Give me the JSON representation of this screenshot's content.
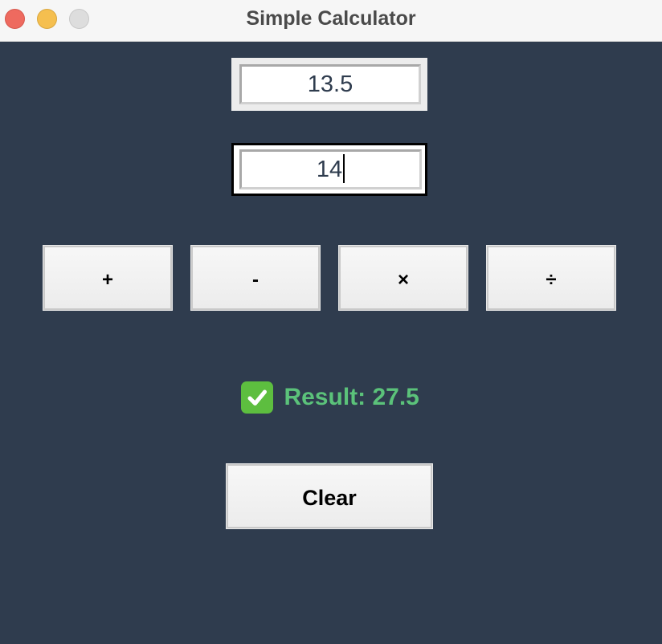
{
  "window": {
    "title": "Simple Calculator",
    "controls": [
      "close-icon",
      "minimize-icon",
      "zoom-icon"
    ]
  },
  "inputs": {
    "first_value": "13.5",
    "second_value": "14"
  },
  "operations": [
    {
      "label": "+"
    },
    {
      "label": "-"
    },
    {
      "label": "×"
    },
    {
      "label": "÷"
    }
  ],
  "result": {
    "icon": "check-mark-icon",
    "text": "Result: 27.5"
  },
  "actions": {
    "clear_label": "Clear"
  },
  "colors": {
    "background": "#2f3c4e",
    "result_text": "#5bc27a",
    "check_icon": "#5dbe3f"
  }
}
